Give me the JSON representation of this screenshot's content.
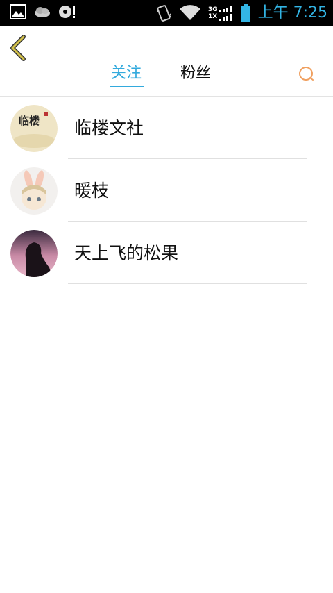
{
  "status_bar": {
    "time": "上午 7:25",
    "net_top": "3G",
    "net_bottom": "1X"
  },
  "tabs": [
    {
      "label": "关注",
      "active": true
    },
    {
      "label": "粉丝",
      "active": false
    }
  ],
  "following": [
    {
      "name": "临楼文社",
      "avatar_text": "临楼"
    },
    {
      "name": "暖枝"
    },
    {
      "name": "天上飞的松果"
    }
  ],
  "colors": {
    "accent": "#33aadd",
    "back_icon": "#d4c24a",
    "search_icon": "#f0a060"
  }
}
